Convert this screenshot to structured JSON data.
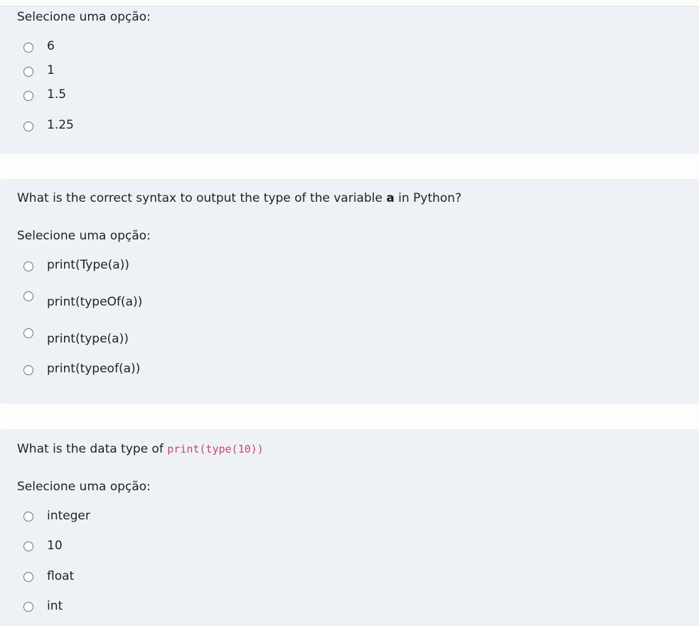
{
  "questions": [
    {
      "prompt": "Selecione uma opção:",
      "options": [
        "6",
        "1",
        "1.5",
        "1.25"
      ]
    },
    {
      "text_before": "What is the correct syntax to output the type of the variable ",
      "text_bold": "a",
      "text_after": " in Python?",
      "prompt": "Selecione uma opção:",
      "options": [
        "print(Type(a))",
        "print(typeOf(a))",
        "print(type(a))",
        "print(typeof(a))"
      ]
    },
    {
      "text_before": "What is the data type of ",
      "text_code": "print(type(10))",
      "prompt": "Selecione uma opção:",
      "options": [
        "integer",
        "10",
        "float",
        "int"
      ]
    }
  ],
  "colors": {
    "card_background": "#eef2f6",
    "page_background": "#fdfdfc",
    "code_text": "#c7457a",
    "radio_border": "#6a737b"
  }
}
